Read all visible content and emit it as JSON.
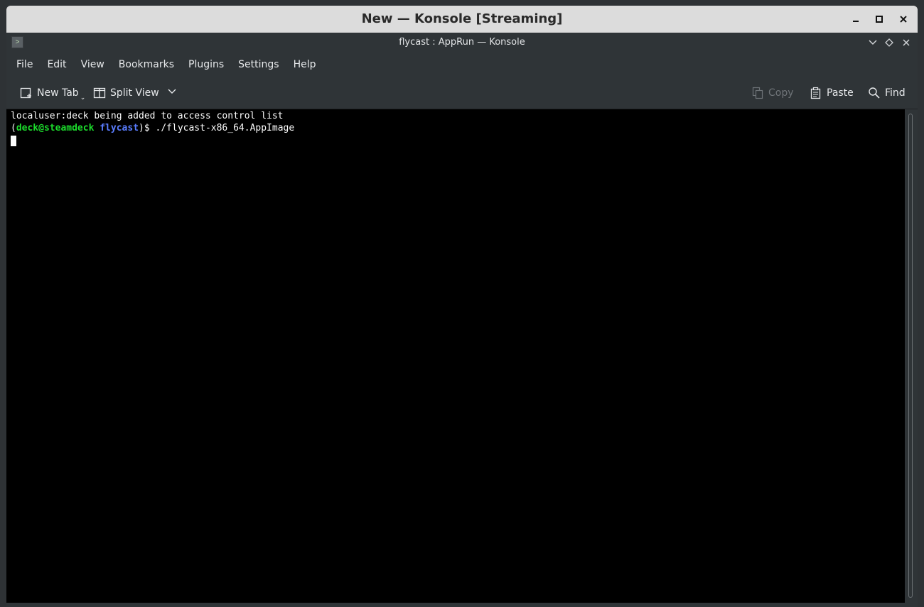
{
  "stream_window": {
    "title": "New — Konsole [Streaming]",
    "controls": [
      "minimize-icon",
      "maximize-icon",
      "close-icon"
    ]
  },
  "konsole": {
    "title": "flycast : AppRun — Konsole",
    "menu": [
      "File",
      "Edit",
      "View",
      "Bookmarks",
      "Plugins",
      "Settings",
      "Help"
    ],
    "toolbar": {
      "new_tab": "New Tab",
      "split_view": "Split View",
      "copy": "Copy",
      "paste": "Paste",
      "find": "Find"
    }
  },
  "terminal": {
    "line1": "localuser:deck being added to access control list",
    "prompt_open": "(",
    "user_host": "deck@steamdeck",
    "cwd": "flycast",
    "prompt_close": ")$ ",
    "command": "./flycast-x86_64.AppImage"
  },
  "colors": {
    "prompt_user": "#1cdc2c",
    "prompt_dir": "#5a7dff",
    "terminal_bg": "#000000",
    "chrome_bg": "#2f3437"
  }
}
